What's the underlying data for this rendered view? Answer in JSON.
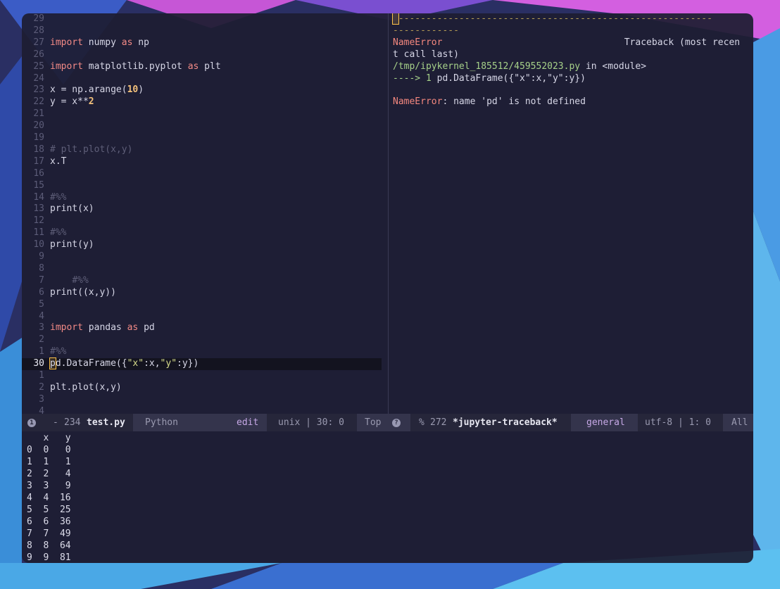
{
  "left_pane": {
    "lines": [
      {
        "ln": "29",
        "html": ""
      },
      {
        "ln": "28",
        "html": ""
      },
      {
        "ln": "27",
        "html": "<span class='kw'>import</span> numpy <span class='kw'>as</span> np"
      },
      {
        "ln": "26",
        "html": ""
      },
      {
        "ln": "25",
        "html": "<span class='kw'>import</span> matplotlib.pyplot <span class='kw'>as</span> plt"
      },
      {
        "ln": "24",
        "html": ""
      },
      {
        "ln": "23",
        "html": "x = np.arange(<span class='num'>10</span>)"
      },
      {
        "ln": "22",
        "html": "y = x**<span class='num'>2</span>"
      },
      {
        "ln": "21",
        "html": ""
      },
      {
        "ln": "20",
        "html": ""
      },
      {
        "ln": "19",
        "html": ""
      },
      {
        "ln": "18",
        "html": "<span class='cm'># plt.plot(x,y)</span>"
      },
      {
        "ln": "17",
        "html": "x.T"
      },
      {
        "ln": "16",
        "html": ""
      },
      {
        "ln": "15",
        "html": ""
      },
      {
        "ln": "14",
        "html": "<span class='cm'>#%%</span>"
      },
      {
        "ln": "13",
        "html": "print(x)"
      },
      {
        "ln": "12",
        "html": ""
      },
      {
        "ln": "11",
        "html": "<span class='cm'>#%%</span>"
      },
      {
        "ln": "10",
        "html": "print(y)"
      },
      {
        "ln": "9",
        "html": ""
      },
      {
        "ln": "8",
        "html": ""
      },
      {
        "ln": "7",
        "html": "    <span class='cm'>#%%</span>"
      },
      {
        "ln": "6",
        "html": "print((x,y))"
      },
      {
        "ln": "5",
        "html": ""
      },
      {
        "ln": "4",
        "html": ""
      },
      {
        "ln": "3",
        "html": "<span class='kw'>import</span> pandas <span class='kw'>as</span> pd"
      },
      {
        "ln": "2",
        "html": ""
      },
      {
        "ln": "1",
        "html": "<span class='cm'>#%%</span>"
      },
      {
        "ln": "30",
        "html": "<span class='cursor'>p</span>d.DataFrame({<span class='str'>\"x\"</span>:x,<span class='str'>\"y\"</span>:y})",
        "current": true
      },
      {
        "ln": "1",
        "html": ""
      },
      {
        "ln": "2",
        "html": "plt.plot(x,y)"
      },
      {
        "ln": "3",
        "html": ""
      },
      {
        "ln": "4",
        "html": ""
      }
    ]
  },
  "right_pane": {
    "lines": [
      {
        "html": "<span class='cursor'> </span><span class='dashes'>---------------------------------------------------------</span>"
      },
      {
        "html": "<span class='dashes'>------------</span>"
      },
      {
        "html": "<span class='red'>NameError</span>                                 <span class='dim'>Traceback (most recen</span>"
      },
      {
        "html": "<span class='dim'>t call last)</span>"
      },
      {
        "html": "<span class='grn'>/tmp/ipykernel_185512/459552023.py</span> <span class='dim'>in</span> <span class='dim'>&lt;module&gt;</span>"
      },
      {
        "html": "<span class='grn'>----&gt; 1</span> <span class='dim'>pd.DataFrame({\"x\":x,\"y\":y})</span>"
      },
      {
        "html": ""
      },
      {
        "html": "<span class='red'>NameError</span><span class='dim'>: name 'pd' is not defined</span>"
      }
    ]
  },
  "modeline": {
    "left": {
      "badge": "1",
      "dash": "-",
      "size": "234",
      "filename": "test.py",
      "mode": "Python",
      "state": "edit",
      "encoding": "unix | 30: 0",
      "position": "Top"
    },
    "right": {
      "badge": "?",
      "pct": "%",
      "size": "272",
      "buffer": "*jupyter-traceback*",
      "workspace": "general",
      "encoding": "utf-8 | 1: 0",
      "position": "All"
    }
  },
  "output": {
    "header": "   x   y",
    "rows": [
      "0  0   0",
      "1  1   1",
      "2  2   4",
      "3  3   9",
      "4  4  16",
      "5  5  25",
      "6  6  36",
      "7  7  49",
      "8  8  64",
      "9  9  81"
    ]
  },
  "colors": {
    "keyword": "#f38a86",
    "number": "#f3c17b",
    "string": "#d6dc8a",
    "comment": "#5e5e78",
    "error": "#f3877e",
    "path": "#a6d189",
    "cursor": "#ffc24a"
  }
}
